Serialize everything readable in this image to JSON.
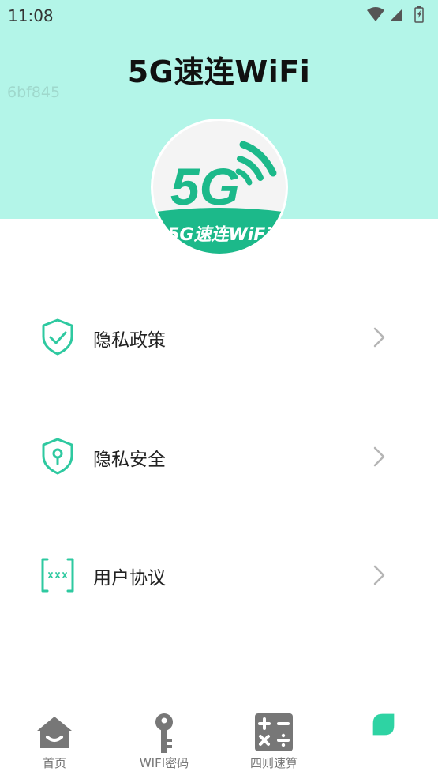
{
  "status_bar": {
    "time": "11:08",
    "icons": [
      "wifi-icon",
      "signal-icon",
      "battery-icon"
    ]
  },
  "header": {
    "title": "5G速连WiFi",
    "build_id": "6bf845",
    "background_color": "#b3f5e8"
  },
  "logo": {
    "text": "5G速连WiFi",
    "badge_text": "5G",
    "brand_color": "#1cb98a"
  },
  "menu": [
    {
      "label": "隐私政策",
      "icon": "shield-check-icon"
    },
    {
      "label": "隐私安全",
      "icon": "shield-keyhole-icon"
    },
    {
      "label": "用户协议",
      "icon": "document-password-icon"
    }
  ],
  "tabbar": {
    "items": [
      {
        "label": "首页",
        "icon": "home-icon"
      },
      {
        "label": "WIFI密码",
        "icon": "key-icon"
      },
      {
        "label": "四则速算",
        "icon": "calculator-icon"
      },
      {
        "label": "",
        "icon": "leaf-icon"
      }
    ]
  },
  "colors": {
    "accent": "#2ec9a0",
    "tab_icon_gray": "#777777",
    "chevron_gray": "#b5b5b5"
  }
}
